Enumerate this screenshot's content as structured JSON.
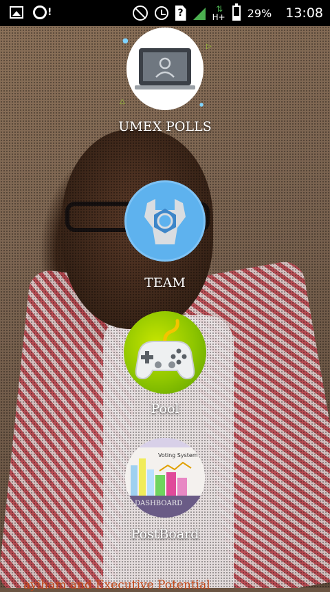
{
  "status_bar": {
    "battery": "29%",
    "battery_level": 0.29,
    "time": "13:08",
    "network_type": "H+",
    "sim_label": "?"
  },
  "menu": [
    {
      "label": "UMEX POLLS",
      "icon": "laptop-user-icon"
    },
    {
      "label": "TEAM",
      "icon": "wrench-nut-icon"
    },
    {
      "label": "Pool",
      "icon": "gamepad-icon"
    },
    {
      "label": "PostBoard",
      "icon": "dashboard-thumbnail-icon"
    }
  ],
  "postboard_thumb": {
    "title": "Voting System",
    "caption": "DASHBOARD"
  },
  "footer_text": "ayiham and Executive Potential",
  "colors": {
    "team_blue": "#5eb2ee",
    "pool_green": "#8cc400",
    "status_green": "#4caf50"
  }
}
